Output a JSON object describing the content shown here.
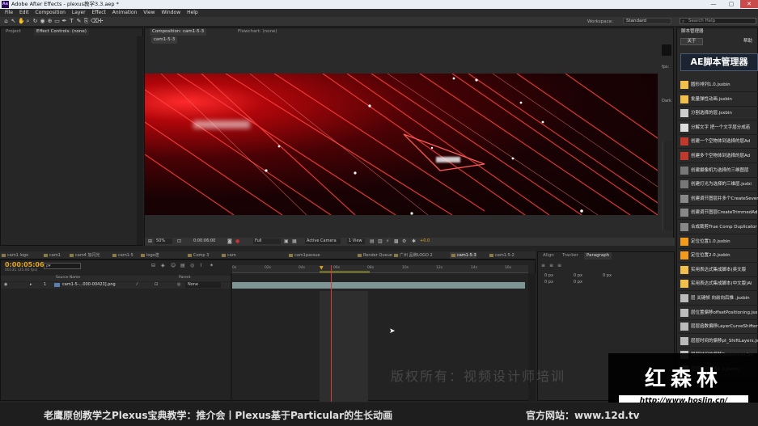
{
  "window": {
    "title": "Adobe After Effects - plexus教学3.3.aep *",
    "app_abbr": "Ae"
  },
  "menu": [
    "File",
    "Edit",
    "Composition",
    "Layer",
    "Effect",
    "Animation",
    "View",
    "Window",
    "Help"
  ],
  "toolbar": {
    "workspace_label": "Workspace:",
    "workspace_value": "Standard",
    "search_placeholder": "Search Help"
  },
  "left_panel": {
    "tabs": [
      "Project",
      "Effect Controls: (none)"
    ]
  },
  "composition": {
    "tab": "Composition: cam1-5-3",
    "flowchart_tab": "Flowchart: (none)",
    "crumb": "cam1-5-3",
    "fps_label": "fps:",
    "dark_label": "Dark",
    "zoom": "50%",
    "timecode": "0:00:06:00",
    "resolution": "Full",
    "camera": "Active Camera",
    "views": "1 View",
    "exposure": "+0.0"
  },
  "script_panel": {
    "title": "脚本管理器",
    "close_label": "关于",
    "help_label": "帮助",
    "logo": "AE脚本管理器",
    "items": [
      {
        "label": "圆形排列1.0.jsxbin",
        "color": "#f2c04a"
      },
      {
        "label": "批量弹性动画.jsxbin",
        "color": "#f2c04a"
      },
      {
        "label": "分割选择的层.jsxbin",
        "color": "#cccccc"
      },
      {
        "label": "分解文字 把一个文字层分成若",
        "color": "#dddddd"
      },
      {
        "label": "创建一个空物体到选择的层Ad",
        "color": "#c0392b"
      },
      {
        "label": "创建多个空物体到选择的层Ad",
        "color": "#c0392b"
      },
      {
        "label": "创建摄像机为选择的三维图层",
        "color": "#777777"
      },
      {
        "label": "创建灯光为选择的三维层.jsxbi",
        "color": "#777777"
      },
      {
        "label": "创建调节图层并多个CreateSevera",
        "color": "#888888"
      },
      {
        "label": "创建调节图层CreateTrimmedAd",
        "color": "#888888"
      },
      {
        "label": "合成裁剪True Comp Duplicator",
        "color": "#888888"
      },
      {
        "label": "定位位置1.0.jsxbin",
        "color": "#f29b1a"
      },
      {
        "label": "定位位置2.0.jsxbin",
        "color": "#f29b1a"
      },
      {
        "label": "实用表达式集成脚本(英文版",
        "color": "#f2c04a"
      },
      {
        "label": "实用表达式集成脚本(中文版)Al",
        "color": "#f2c04a"
      },
      {
        "label": "层 关键帧 向前向后推 .jsxbin",
        "color": "#bbbbbb"
      },
      {
        "label": "层位置偏移offsetPositioning.jsx",
        "color": "#bbbbbb"
      },
      {
        "label": "层层函数偏移LayerCurveShifter",
        "color": "#bbbbbb"
      },
      {
        "label": "层层时间的偏移pt_ShiftLayers.jsxbin",
        "color": "#bbbbbb"
      },
      {
        "label": "层层时间的偏移Sequencer.jsx",
        "color": "#bbbbbb"
      },
      {
        "label": "层层时间偏移1.0.jsxbin",
        "color": "#bbbbbb"
      }
    ]
  },
  "timeline": {
    "tabs": [
      "cam1 logo",
      "cam1",
      "cam4 加闪光",
      "cam1-5",
      "logo渲",
      "Comp 3",
      "cam",
      "cam1passue",
      "Render Queue",
      "广州 品牌LOGO 2",
      "cam1-5-3",
      "cam1-5-2"
    ],
    "active_tab": "cam1-5-3",
    "timecode": "0:00:05:06",
    "frame_info": "00131 (25.00 fps)",
    "search_placeholder": "ρ▾",
    "columns": {
      "source_name": "Source Name",
      "parent": "Parent"
    },
    "ruler": [
      "0s",
      "02s",
      "04s",
      "06s",
      "08s",
      "10s",
      "12s",
      "14s",
      "16s"
    ],
    "layer": {
      "index": "1",
      "name": "cam1-5-...000-00423].png",
      "parent": "None"
    }
  },
  "right_mid_panel": {
    "tabs": [
      "Align",
      "Tracker",
      "Paragraph"
    ],
    "values": [
      "0 px",
      "0 px",
      "0 px",
      "0 px",
      "0 px"
    ]
  },
  "overlay": {
    "copyright": "版权所有：视频设计师培训",
    "brand": "红森林",
    "brand_url": "http://www.hoslin.cn/",
    "caption": "老鹰原创教学之Plexus宝典教学：推介会丨Plexus基于Particular的生长动画",
    "site": "官方网站：www.12d.tv"
  },
  "colors": {
    "accent": "#e8a531",
    "timecode": "#e5a623",
    "playhead": "#d53b3b"
  }
}
